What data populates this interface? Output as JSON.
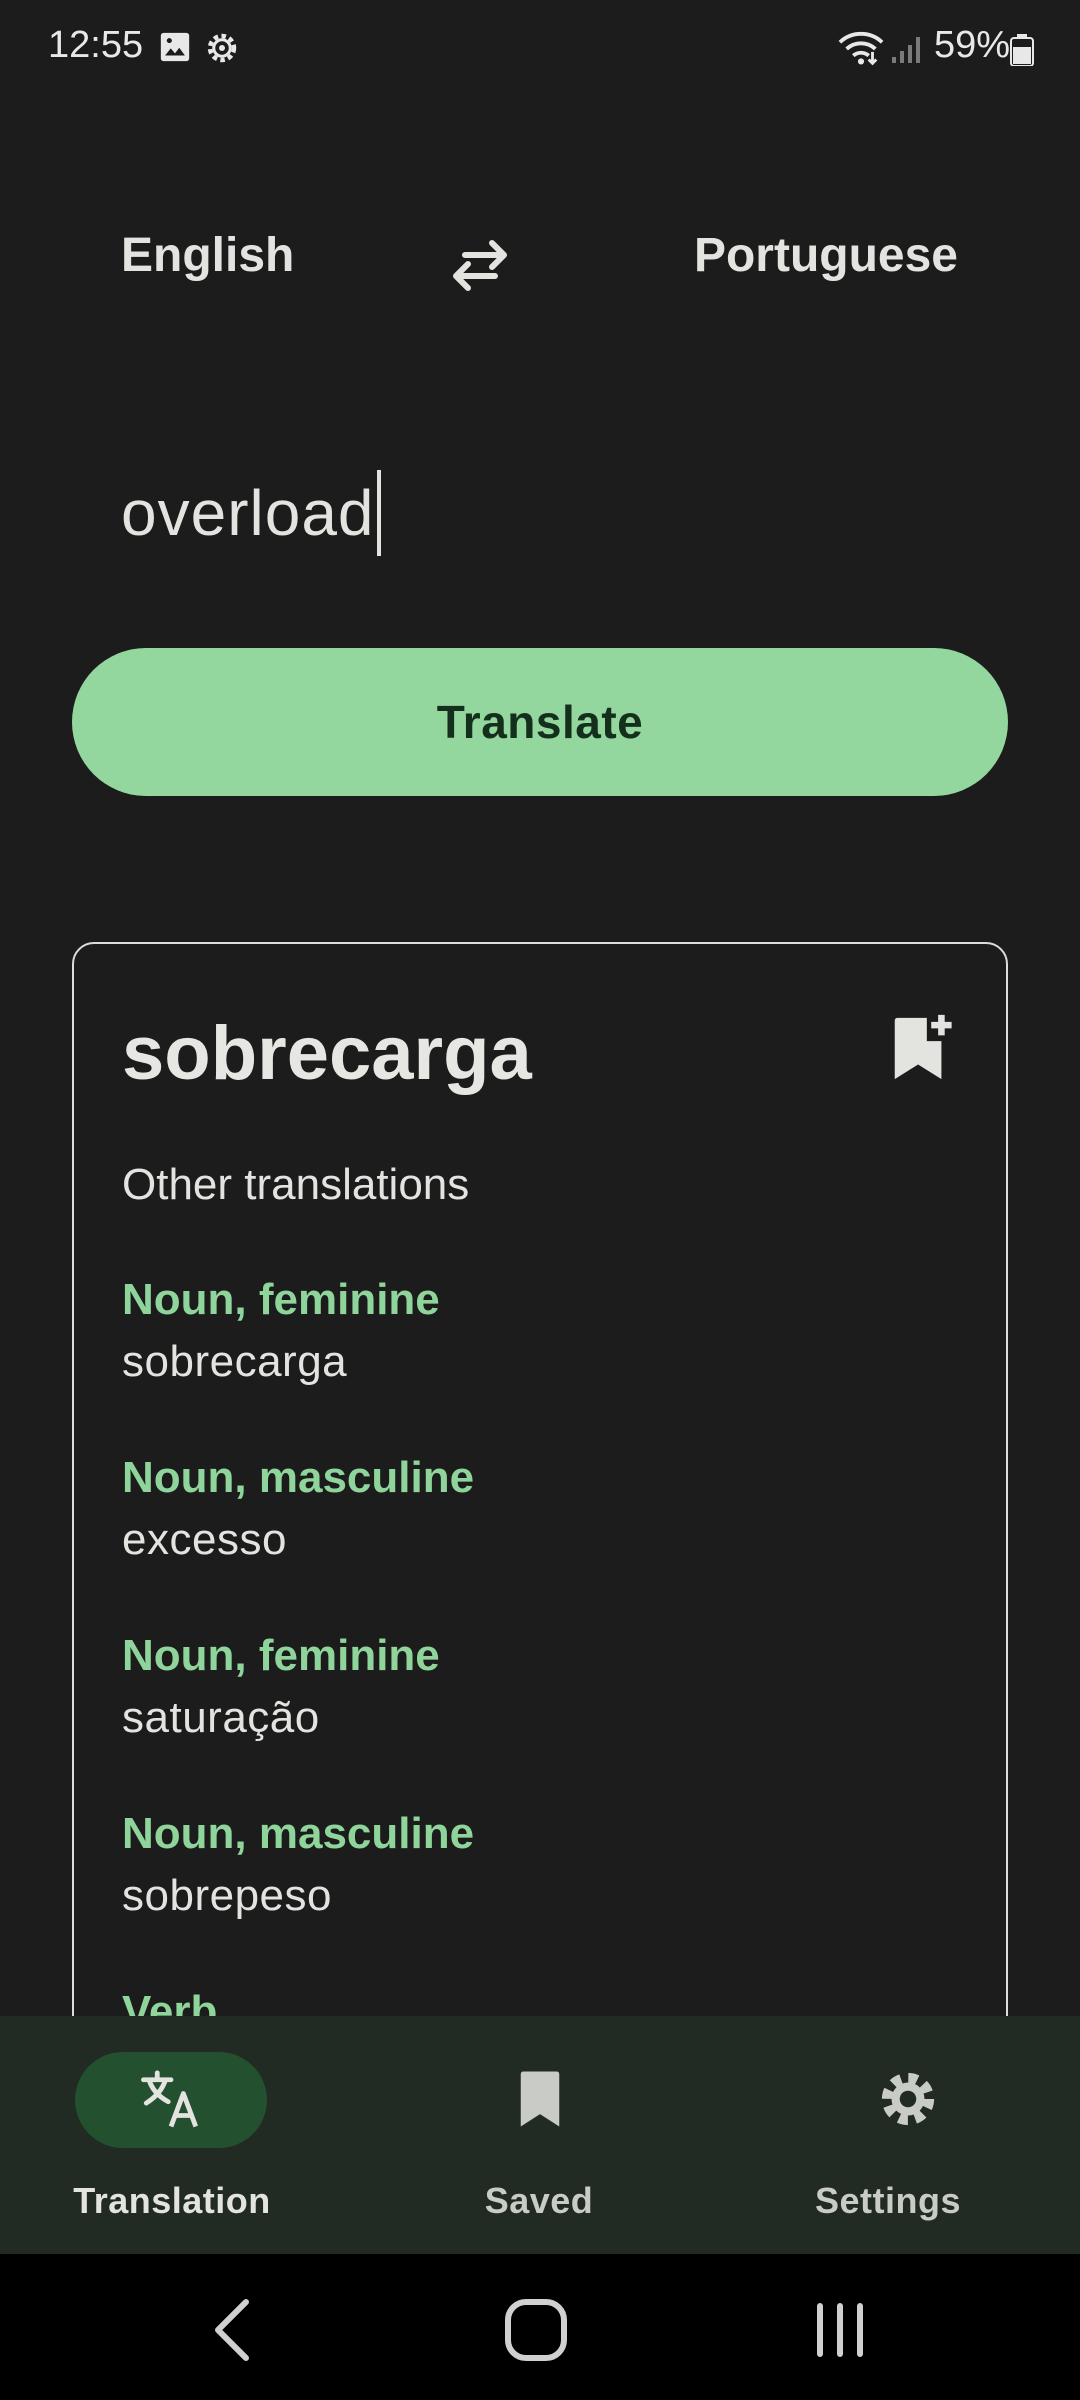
{
  "status_bar": {
    "time": "12:55",
    "battery": "59%",
    "icons": [
      "image-icon",
      "settings-gear-icon",
      "wifi-icon",
      "signal-icon",
      "battery-icon"
    ]
  },
  "languages": {
    "source": "English",
    "target": "Portuguese",
    "swap_icon": "swap-arrows-icon"
  },
  "input": {
    "value": "overload"
  },
  "translate_button": {
    "label": "Translate"
  },
  "result": {
    "main_translation": "sobrecarga",
    "bookmark_icon": "bookmark-add-icon",
    "other_label": "Other translations",
    "entries": [
      {
        "pos": "Noun, feminine",
        "word": "sobrecarga"
      },
      {
        "pos": "Noun, masculine",
        "word": "excesso"
      },
      {
        "pos": "Noun, feminine",
        "word": "saturação"
      },
      {
        "pos": "Noun, masculine",
        "word": "sobrepeso"
      },
      {
        "pos": "Verb",
        "word": ""
      }
    ]
  },
  "bottom_nav": {
    "items": [
      {
        "label": "Translation",
        "icon": "translate-icon",
        "active": true
      },
      {
        "label": "Saved",
        "icon": "bookmark-icon",
        "active": false
      },
      {
        "label": "Settings",
        "icon": "gear-icon",
        "active": false
      }
    ]
  },
  "system_nav": {
    "icons": [
      "back-icon",
      "home-icon",
      "recents-icon"
    ]
  },
  "colors": {
    "background": "#1b1c1b",
    "accent": "#93d79f",
    "accent_text": "#8fd49b",
    "nav_background": "#222a24",
    "active_pill": "#23502f"
  }
}
